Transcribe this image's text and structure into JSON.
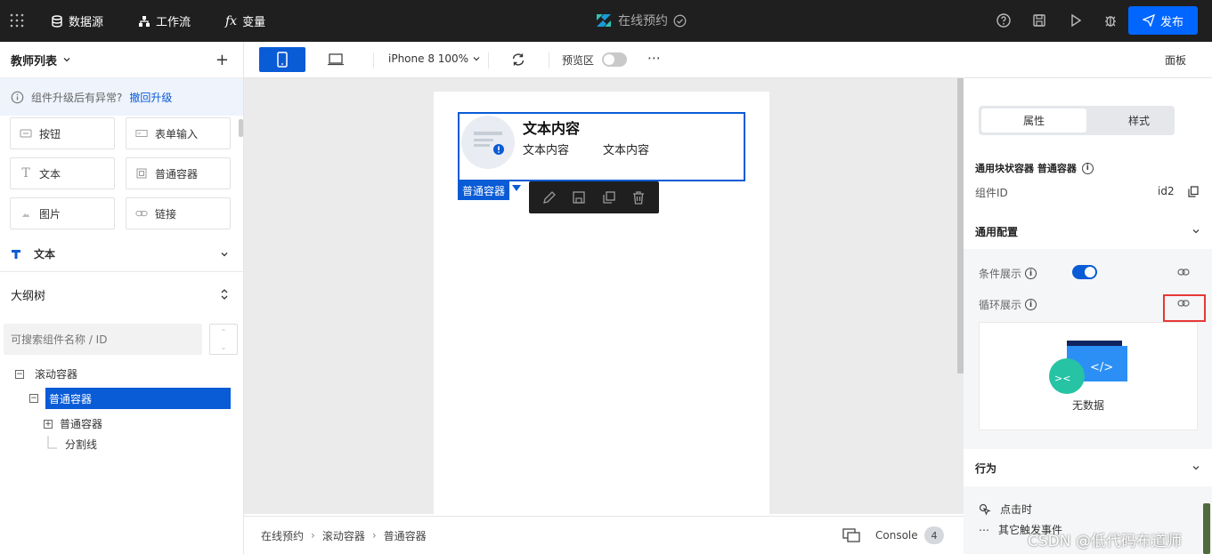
{
  "topbar": {
    "nav": [
      {
        "label": "数据源",
        "icon": "database-icon"
      },
      {
        "label": "工作流",
        "icon": "workflow-icon"
      },
      {
        "label": "变量",
        "icon": "fx-icon"
      }
    ],
    "app_title": "在线预约",
    "publish_label": "发布"
  },
  "left": {
    "page_title": "教师列表",
    "notice_text": "组件升级后有异常?",
    "notice_link": "撤回升级",
    "components": [
      {
        "label": "按钮",
        "icon": "button-icon"
      },
      {
        "label": "表单输入",
        "icon": "form-input-icon"
      },
      {
        "label": "文本",
        "icon": "text-icon"
      },
      {
        "label": "普通容器",
        "icon": "container-icon"
      },
      {
        "label": "图片",
        "icon": "image-icon"
      },
      {
        "label": "链接",
        "icon": "link-icon"
      }
    ],
    "section_text": "文本",
    "outline_title": "大纲树",
    "search_placeholder": "可搜索组件名称 / ID",
    "tree": {
      "root": "滚动容器",
      "selected": "普通容器",
      "child1": "普通容器",
      "child2": "分割线"
    }
  },
  "toolbar": {
    "device": "iPhone 8 100%",
    "preview_label": "预览区",
    "more": "⋯",
    "panel_label": "面板"
  },
  "canvas": {
    "title": "文本内容",
    "text1": "文本内容",
    "text2": "文本内容",
    "tag": "普通容器"
  },
  "footer": {
    "breadcrumb": [
      "在线预约",
      "滚动容器",
      "普通容器"
    ],
    "console_label": "Console",
    "console_count": "4"
  },
  "right": {
    "tab_props": "属性",
    "tab_style": "样式",
    "component_type": "通用块状容器 普通容器",
    "id_label": "组件ID",
    "id_value": "id2",
    "general_config": "通用配置",
    "cond_show": "条件展示",
    "loop_show": "循环展示",
    "empty_text": "无数据",
    "behavior": "行为",
    "on_click": "点击时",
    "other_events": "其它触发事件"
  },
  "watermark": "CSDN @低代码布道师",
  "colors": {
    "accent": "#0a5bd6",
    "publish": "#0066ff",
    "topbar": "#1f1f1f",
    "highlight": "#e53935"
  }
}
